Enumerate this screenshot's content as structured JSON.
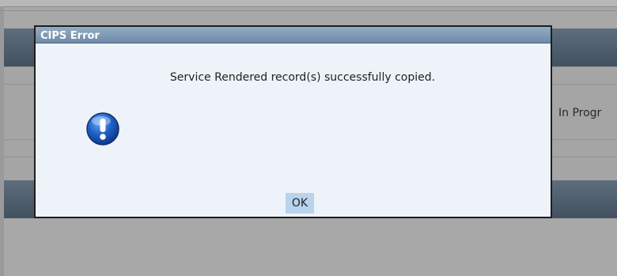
{
  "background": {
    "status_text": "In Progr"
  },
  "dialog": {
    "title": "CIPS Error",
    "message": "Service Rendered record(s) successfully copied.",
    "icon": "exclamation-icon",
    "ok_label": "OK"
  },
  "colors": {
    "titlebar": "#7f99b5",
    "dialog_bg": "#eef3f9",
    "ok_button": "#b7d3ee",
    "icon_blue": "#1f5fc2",
    "overlay": "#a8a8a8"
  }
}
